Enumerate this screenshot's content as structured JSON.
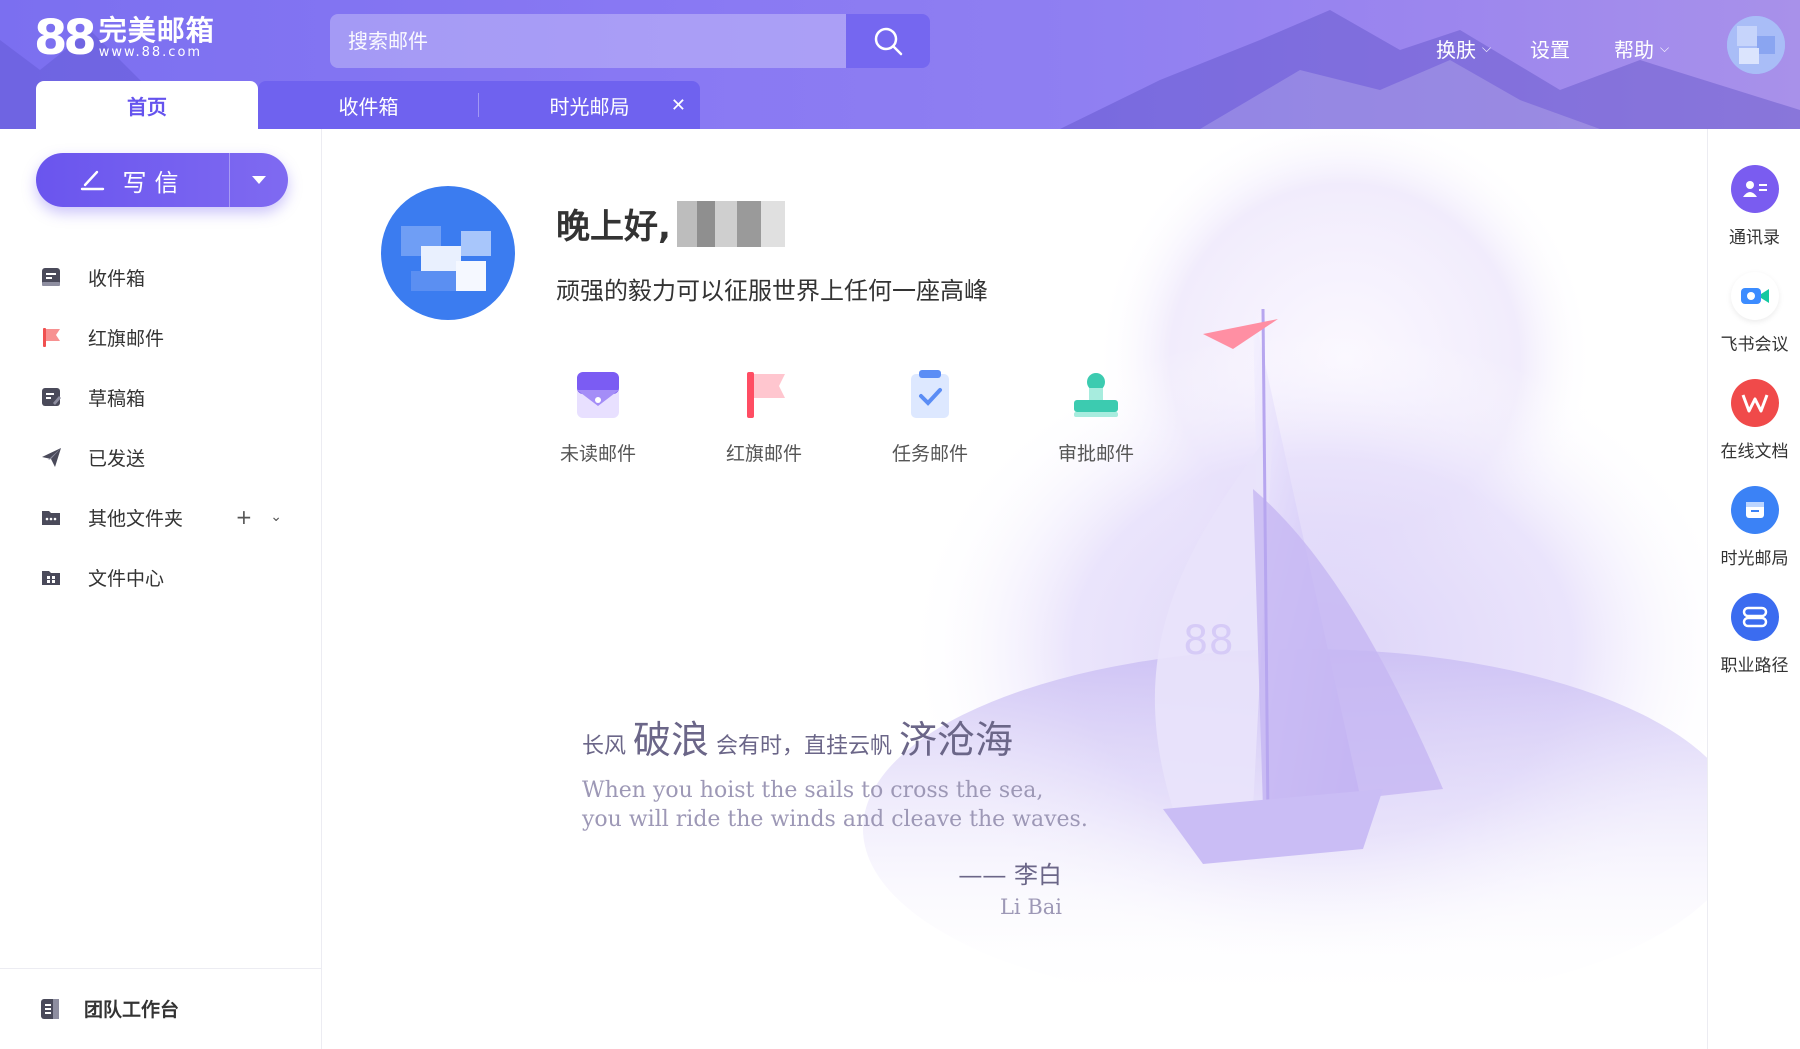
{
  "header": {
    "logo_mark": "88",
    "logo_name": "完美邮箱",
    "logo_url": "www.88.com",
    "search_placeholder": "搜索邮件",
    "menu": {
      "skin": "换肤",
      "settings": "设置",
      "help": "帮助"
    }
  },
  "tabs": [
    {
      "label": "首页"
    },
    {
      "label": "收件箱"
    },
    {
      "label": "时光邮局"
    }
  ],
  "sidebar": {
    "compose_label": "写信",
    "items": [
      {
        "label": "收件箱",
        "icon": "inbox-icon"
      },
      {
        "label": "红旗邮件",
        "icon": "red-flag-icon"
      },
      {
        "label": "草稿箱",
        "icon": "draft-icon"
      },
      {
        "label": "已发送",
        "icon": "sent-icon"
      },
      {
        "label": "其他文件夹",
        "icon": "folder-icon"
      },
      {
        "label": "文件中心",
        "icon": "file-center-icon"
      }
    ],
    "team_label": "团队工作台"
  },
  "main": {
    "greeting": "晚上好,",
    "motto": "顽强的毅力可以征服世界上任何一座高峰",
    "quick": [
      {
        "label": "未读邮件",
        "icon": "unread-mail-icon"
      },
      {
        "label": "红旗邮件",
        "icon": "flag-mail-icon"
      },
      {
        "label": "任务邮件",
        "icon": "task-mail-icon"
      },
      {
        "label": "审批邮件",
        "icon": "approval-mail-icon"
      }
    ],
    "poem": {
      "p1": "长风",
      "p2": "破浪",
      "p3": "会有时，直挂云帆",
      "p4": "济沧海",
      "en1": "When you hoist the sails to cross the sea,",
      "en2": "you will ride the winds and cleave the waves.",
      "author": "—— 李白",
      "author_en": "Li Bai"
    }
  },
  "rail": [
    {
      "label": "通讯录",
      "color": "#7a5cf0",
      "icon": "contacts-icon"
    },
    {
      "label": "飞书会议",
      "color": "#ffffff",
      "icon": "feishu-meeting-icon"
    },
    {
      "label": "在线文档",
      "color": "#f04a4a",
      "icon": "online-doc-icon"
    },
    {
      "label": "时光邮局",
      "color": "#3b82f6",
      "icon": "time-post-icon"
    },
    {
      "label": "职业路径",
      "color": "#3b6cf0",
      "icon": "career-path-icon"
    }
  ],
  "colors": {
    "accent": "#6553ee",
    "header_start": "#7b6ff0",
    "header_end": "#a891ea"
  }
}
